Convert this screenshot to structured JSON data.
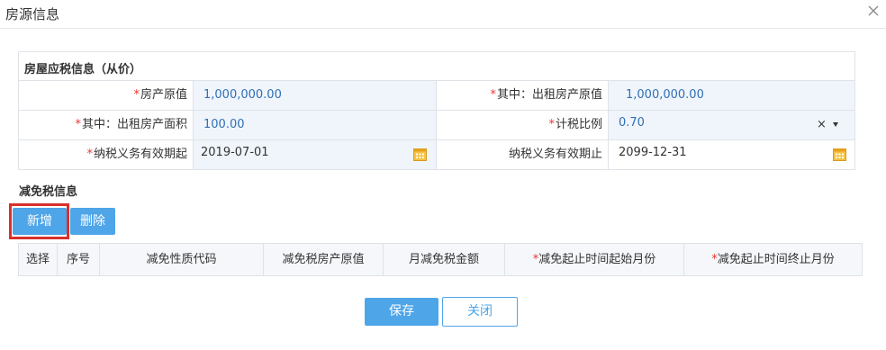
{
  "dialog": {
    "title": "房源信息"
  },
  "taxable_section": {
    "title": "房屋应税信息（从价）",
    "fields": {
      "original_value": {
        "label": "房产原值",
        "value": "1,000,000.00",
        "required": true
      },
      "rental_original_value": {
        "label": "其中：出租房产原值",
        "value": "1,000,000.00",
        "required": true
      },
      "rental_area": {
        "label": "其中：出租房产面积",
        "value": "100.00",
        "required": true
      },
      "tax_ratio": {
        "label": "计税比例",
        "value": "0.70",
        "required": true
      },
      "tax_start": {
        "label": "纳税义务有效期起",
        "value": "2019-07-01",
        "required": true
      },
      "tax_end": {
        "label": "纳税义务有效期止",
        "value": "2099-12-31",
        "required": false
      }
    },
    "required_mark": "*"
  },
  "exemption_section": {
    "title": "减免税信息",
    "buttons": {
      "add": "新增",
      "delete": "删除"
    },
    "columns": [
      "选择",
      "序号",
      "减免性质代码",
      "减免税房产原值",
      "月减免税金额",
      "减免起止时间起始月份",
      "减免起止时间终止月份"
    ],
    "required_columns": [
      5,
      6
    ]
  },
  "footer": {
    "save": "保存",
    "close": "关闭"
  },
  "colors": {
    "accent": "#4ea5e8",
    "value_text": "#2f6fb6",
    "required": "#e33333",
    "highlight": "#d9302c"
  }
}
